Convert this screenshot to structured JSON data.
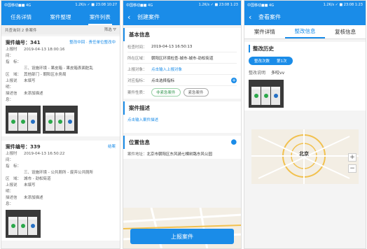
{
  "status": {
    "left": "中国移动■■ 4G",
    "right1": "1.2K/s ✓ ■ 23:08 10:27",
    "right2": "1.2K/s ✓ ■ 23:08 1:23",
    "right3": "1.2K/s ✓ ■ 23:08 1:23"
  },
  "p1": {
    "tabs": [
      "任务详情",
      "案件整理",
      "案件列表"
    ],
    "filter_count": "共查询到 2 条案件",
    "filter_label": "筛选",
    "cards": [
      {
        "code": "案件编号：341",
        "action": "整改中回 · 责任单位整改中",
        "time_k": "上报时间：",
        "time": "2019-04-13 18:00:16",
        "tag_k": "指　标：",
        "tag": "三、设施环境 - 果皮箱 - 果皮箱表面脏乱",
        "region_k": "区　域：",
        "region": "其他部门 - 朝阳区水务局",
        "desc_k": "上报说明：",
        "desc": "未填写",
        "note_k": "描述信息：",
        "note": "未添加描述"
      },
      {
        "code": "案件编号：339",
        "action": "结案",
        "time_k": "上报时间：",
        "time": "2019-04-13 16:50:22",
        "tag_k": "指　标：",
        "tag": "三、设施环境 - 公共厕所 - 废弃公共厕所",
        "region_k": "区　域：",
        "region": "城市 - 劲松街道",
        "desc_k": "上报说明：",
        "desc": "未填写",
        "note_k": "描述信息：",
        "note": "未添加描述"
      }
    ]
  },
  "p2": {
    "title": "创建案件",
    "basic": "基本信息",
    "fields": [
      {
        "k": "检查时间：",
        "v": "2019-04-13 16:50:13"
      },
      {
        "k": "所在区域：",
        "v": "朝阳区环境检查-城市-城市-劲松街道"
      },
      {
        "k": "上报对象：",
        "v": "点击输入上报对象"
      },
      {
        "k": "对应指标：",
        "v": "点击选择指标"
      }
    ],
    "prop_k": "案件性质：",
    "prop_a": "非紧急案件",
    "prop_b": "紧急案件",
    "desc_title": "案件描述",
    "desc_placeholder": "点击输入案件描述",
    "loc_title": "位置信息",
    "addr_k": "案件地址：",
    "addr": "北京市朝阳区东风骑七棵树路东风公园",
    "submit": "上报案件"
  },
  "p3": {
    "title": "查看案件",
    "tabs": [
      "案件详情",
      "整改信息",
      "复核信息"
    ],
    "hist": "整改历史",
    "badge_k": "整改次数",
    "badge_v": "第1次",
    "note_k": "整改说明",
    "note_v": "多咬vv",
    "map_city": "北京",
    "zoom_in": "+",
    "zoom_out": "−"
  },
  "colors": {
    "primary": "#1a8ce8",
    "green": "#3a9a55"
  }
}
